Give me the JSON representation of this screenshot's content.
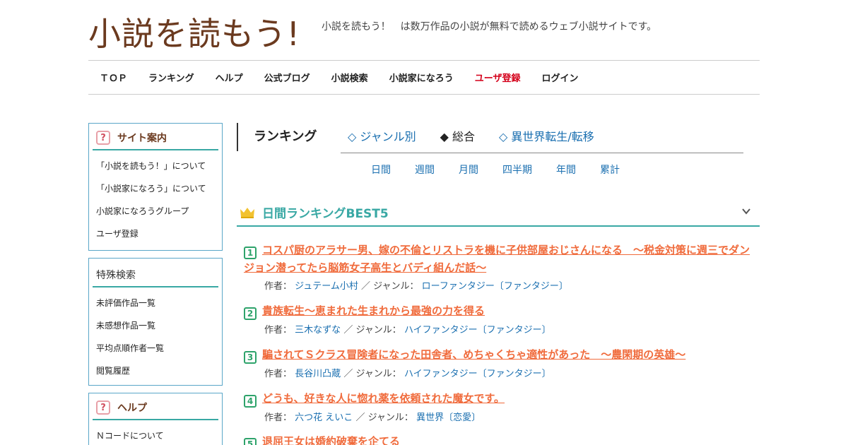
{
  "header": {
    "logo": "小説を読もう!",
    "tagline": "小説を読もう！　は数万作品の小説が無料で読めるウェブ小説サイトです。"
  },
  "nav": {
    "items": [
      "ＴＯＰ",
      "ランキング",
      "ヘルプ",
      "公式ブログ",
      "小説検索",
      "小説家になろう",
      "ユーザ登録",
      "ログイン"
    ]
  },
  "sidebar": {
    "site_guide": {
      "title": "サイト案内",
      "items": [
        "「小説を読もう！」について",
        "「小説家になろう」について",
        "小説家になろうグループ",
        "ユーザ登録"
      ]
    },
    "special_search": {
      "title": "特殊検索",
      "items": [
        "未評価作品一覧",
        "未感想作品一覧",
        "平均点順作者一覧",
        "閲覧履歴"
      ]
    },
    "help": {
      "title": "ヘルプ",
      "items": [
        "Ｎコードについて"
      ]
    },
    "q_glyph": "?"
  },
  "main": {
    "ranking_title": "ランキング",
    "tabs": [
      "◇ ジャンル別",
      "◆ 総合",
      "◇ 異世界転生/転移"
    ],
    "periods": [
      "日間",
      "週間",
      "月間",
      "四半期",
      "年間",
      "累計"
    ],
    "best_label": "日間ランキングBEST5",
    "author_label": "作者：",
    "genre_label": "／ ジャンル：",
    "entries": [
      {
        "rank": "1",
        "title": "コスパ厨のアラサー男、嫁の不倫とリストラを機に子供部屋おじさんになる　～税金対策に週三でダンジョン潜ってたら脳筋女子高生とバディ組んだ話～",
        "author": "ジュテーム小村",
        "genre": "ローファンタジー〔ファンタジー〕"
      },
      {
        "rank": "2",
        "title": "貴族転生～恵まれた生まれから最強の力を得る",
        "author": "三木なずな",
        "genre": "ハイファンタジー〔ファンタジー〕"
      },
      {
        "rank": "3",
        "title": "騙されてＳクラス冒険者になった田舎者、めちゃくちゃ適性があった　～農閑期の英雄～",
        "author": "長谷川凸蔵",
        "genre": "ハイファンタジー〔ファンタジー〕"
      },
      {
        "rank": "4",
        "title": "どうも、好きな人に惚れ薬を依頼された魔女です。",
        "author": "六つ花 えいこ",
        "genre": "異世界〔恋愛〕"
      },
      {
        "rank": "5",
        "title": "退屈王女は婚約破棄を企てる",
        "author": "",
        "genre": ""
      }
    ]
  },
  "colors": {
    "logo": "#6b3a1f",
    "accent_teal": "#39a8a4",
    "title_orange": "#f06b3c",
    "link_blue": "#1a6fb0",
    "register_red": "#d4001a"
  }
}
